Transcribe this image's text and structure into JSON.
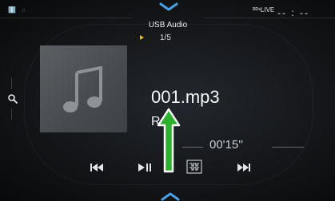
{
  "header": {
    "status_icons": "ℹ️ ♫",
    "source_label": "USB Audio",
    "track_position": "1/5",
    "live_indicator": "ᴿᴰˢLIVE",
    "clock": "-- : --"
  },
  "now_playing": {
    "title": "001.mp3",
    "artist": "Rock",
    "elapsed_time": "00'15''"
  },
  "controls": {
    "previous": "previous-track-icon",
    "play_pause": "play-pause-icon",
    "next": "next-track-icon",
    "extra": "equalizer-icon"
  },
  "overlay": {
    "arrow_color": "#2db02d",
    "arrow_border": "#ffffff"
  },
  "accent": {
    "track_marker": "#e5c100"
  }
}
